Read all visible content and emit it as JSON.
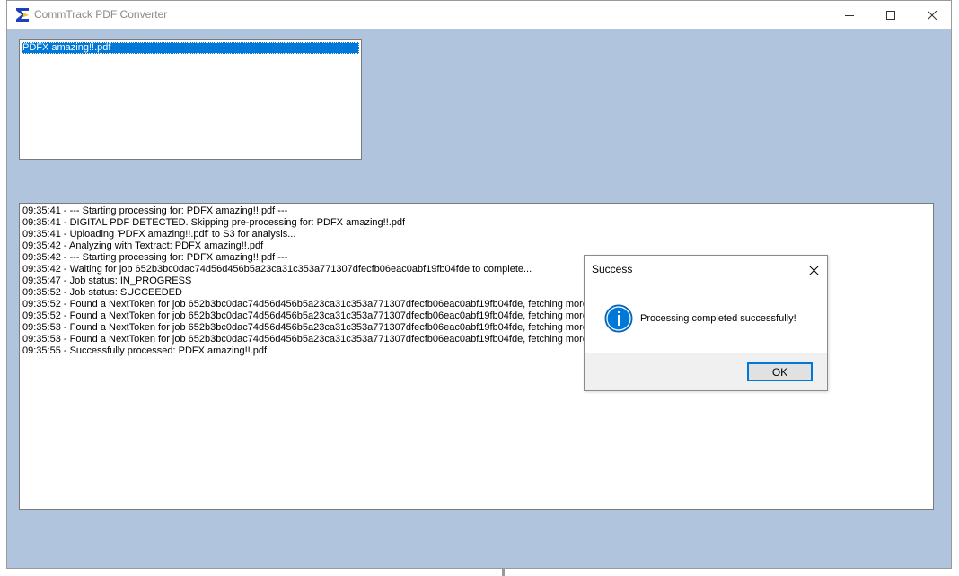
{
  "window": {
    "title": "CommTrack PDF Converter",
    "app_icon": "commtrack-app-icon",
    "controls": [
      "minimize-icon",
      "maximize-icon",
      "close-icon"
    ]
  },
  "file_list": {
    "items": [
      {
        "label": "PDFX amazing!!.pdf",
        "selected": true
      }
    ]
  },
  "log": {
    "lines": [
      "09:35:41 - --- Starting processing for: PDFX amazing!!.pdf ---",
      "09:35:41 - DIGITAL PDF DETECTED. Skipping pre-processing for: PDFX amazing!!.pdf",
      "09:35:41 - Uploading 'PDFX amazing!!.pdf' to S3 for analysis...",
      "09:35:42 - Analyzing with Textract: PDFX amazing!!.pdf",
      "09:35:42 - --- Starting processing for: PDFX amazing!!.pdf ---",
      "09:35:42 - Waiting for job 652b3bc0dac74d56d456b5a23ca31c353a771307dfecfb06eac0abf19fb04fde to complete...",
      "09:35:47 - Job status: IN_PROGRESS",
      "09:35:52 - Job status: SUCCEEDED",
      "09:35:52 - Found a NextToken for job 652b3bc0dac74d56d456b5a23ca31c353a771307dfecfb06eac0abf19fb04fde, fetching more r",
      "09:35:52 - Found a NextToken for job 652b3bc0dac74d56d456b5a23ca31c353a771307dfecfb06eac0abf19fb04fde, fetching more r",
      "09:35:53 - Found a NextToken for job 652b3bc0dac74d56d456b5a23ca31c353a771307dfecfb06eac0abf19fb04fde, fetching more r",
      "09:35:53 - Found a NextToken for job 652b3bc0dac74d56d456b5a23ca31c353a771307dfecfb06eac0abf19fb04fde, fetching more r",
      "09:35:55 - Successfully processed: PDFX amazing!!.pdf"
    ]
  },
  "dialog": {
    "title": "Success",
    "message": "Processing completed successfully!",
    "ok_label": "OK",
    "icon": "info-icon"
  },
  "colors": {
    "window_bg": "#b0c4de",
    "selection": "#0078d7",
    "info_icon": "#0078d7"
  }
}
